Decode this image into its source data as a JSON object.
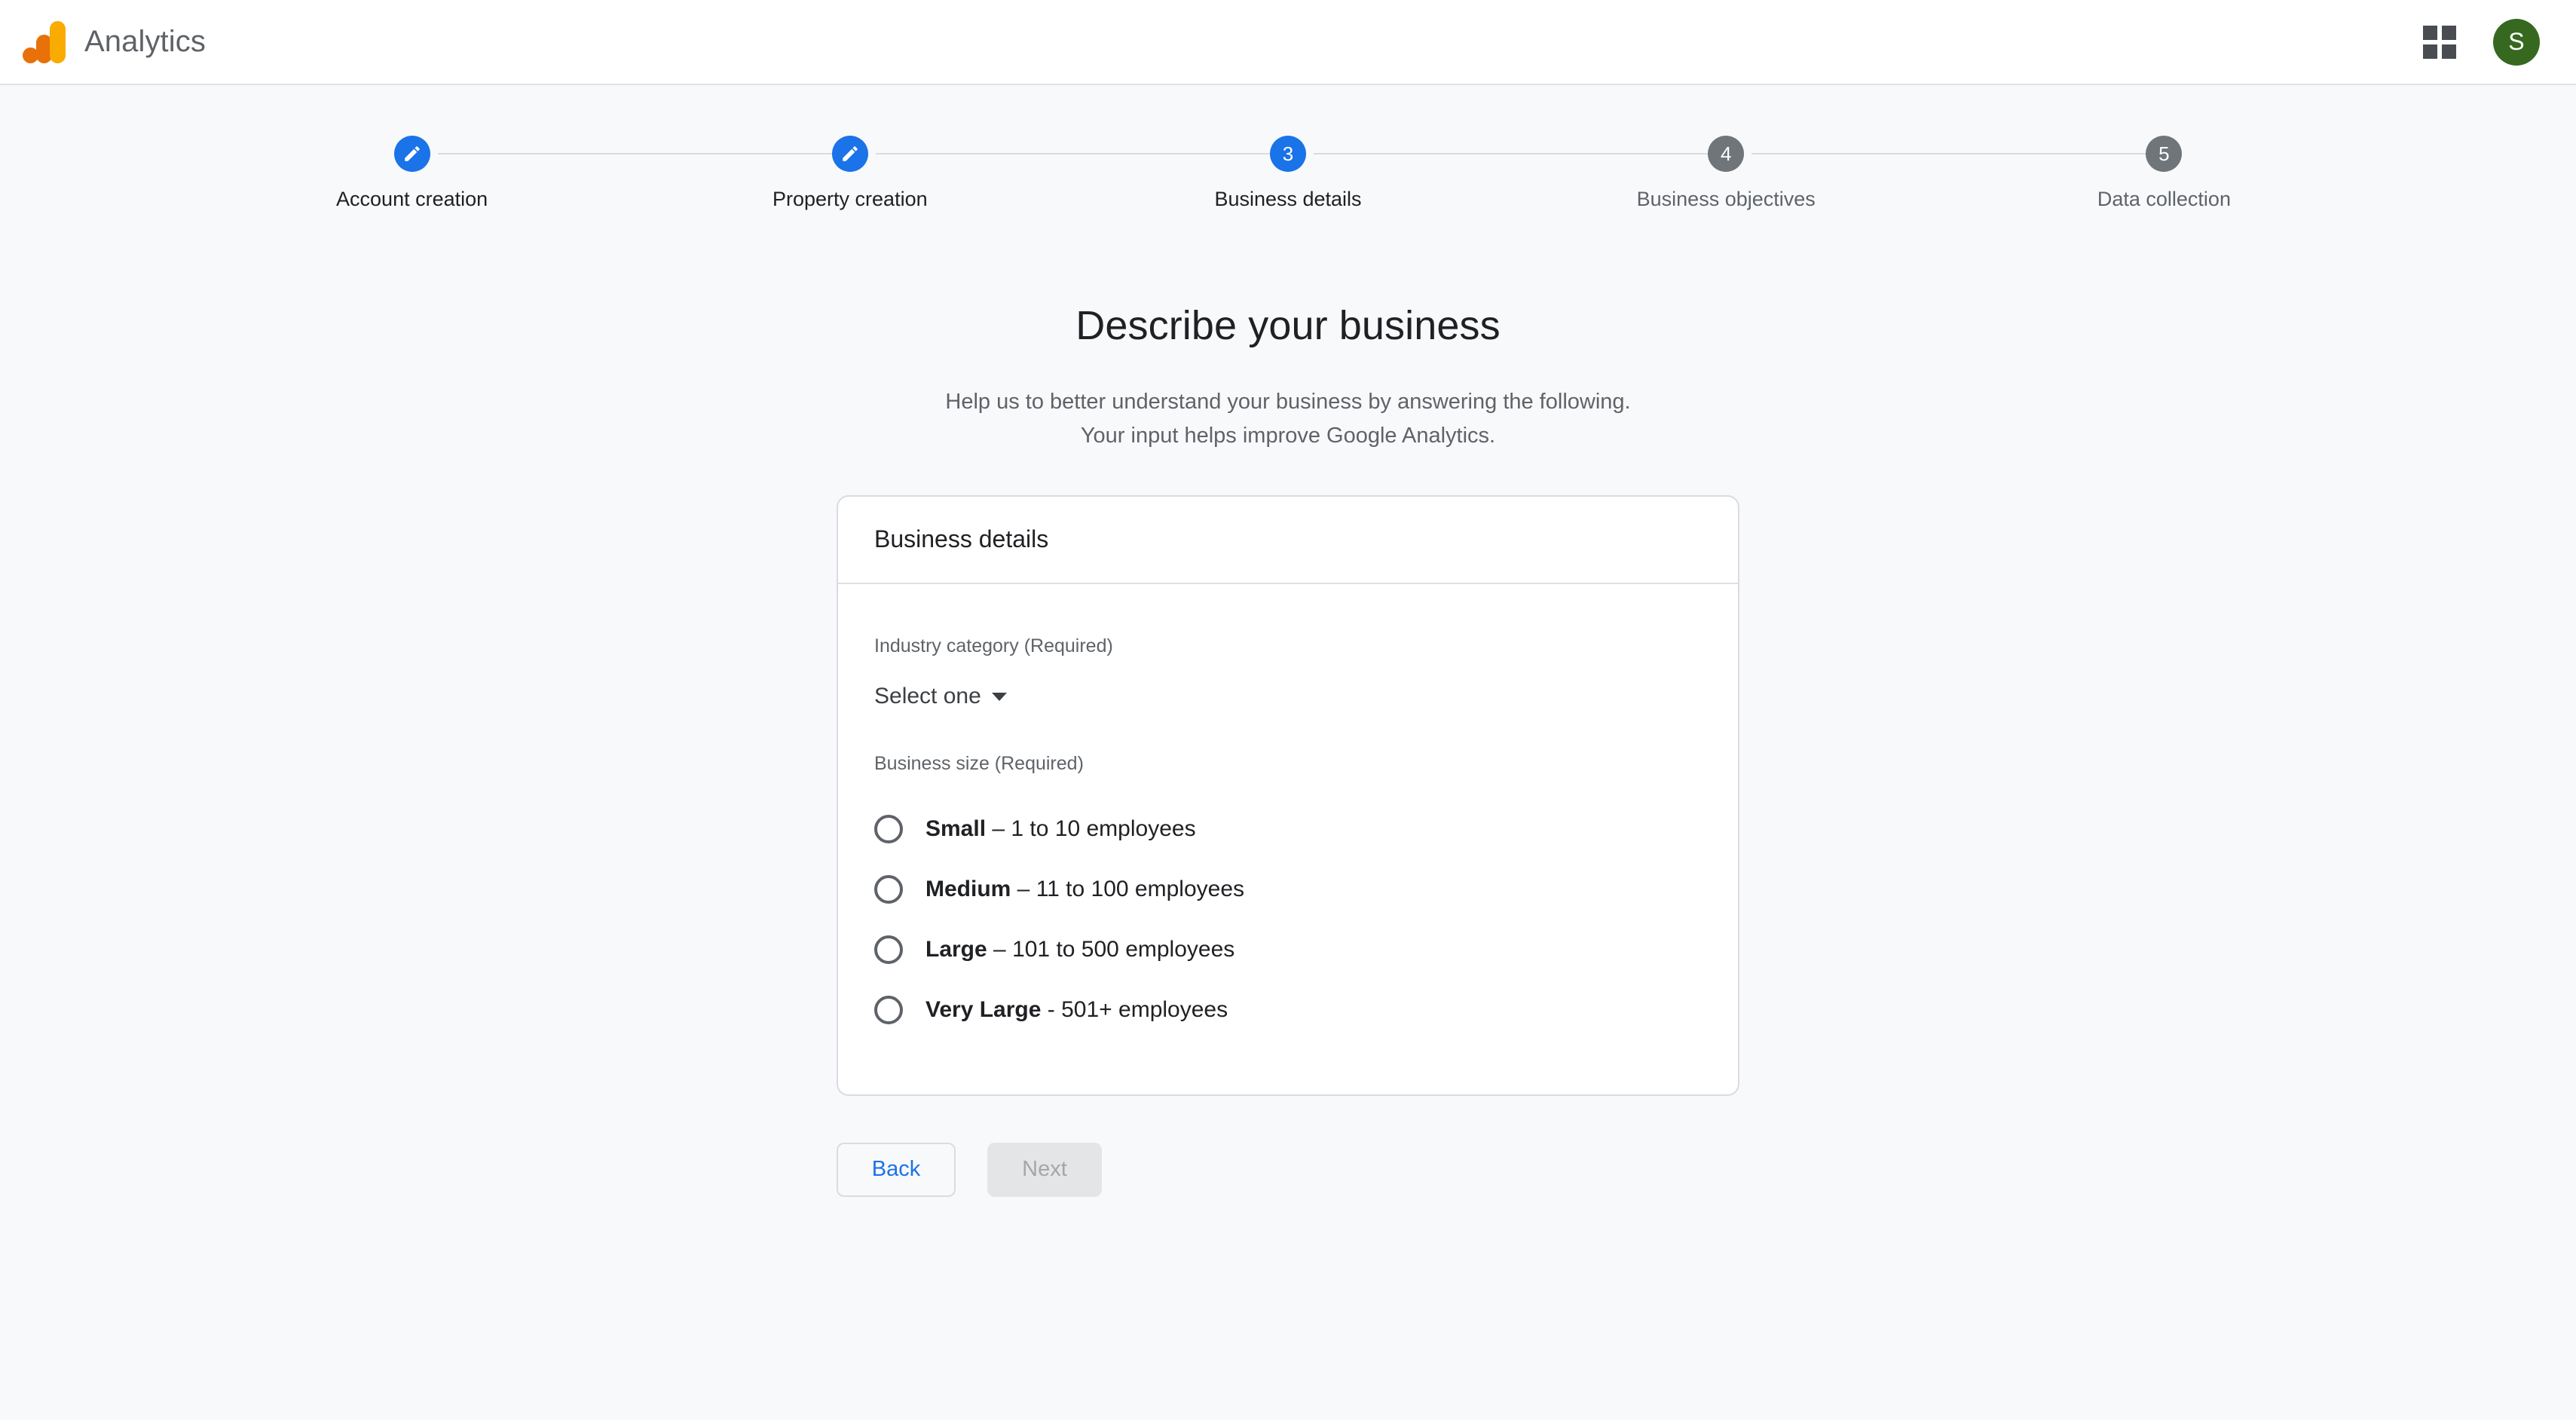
{
  "appbar": {
    "brand_name": "Analytics",
    "logo_icon": "google-analytics-logo",
    "apps_icon": "apps-grid-icon",
    "avatar_initial": "S",
    "avatar_color": "#36691f"
  },
  "stepper": {
    "steps": [
      {
        "marker": "pencil-icon",
        "number": "",
        "label": "Account creation",
        "state": "done"
      },
      {
        "marker": "pencil-icon",
        "number": "",
        "label": "Property creation",
        "state": "done"
      },
      {
        "marker": "number",
        "number": "3",
        "label": "Business details",
        "state": "active"
      },
      {
        "marker": "number",
        "number": "4",
        "label": "Business objectives",
        "state": "todo"
      },
      {
        "marker": "number",
        "number": "5",
        "label": "Data collection",
        "state": "todo"
      }
    ],
    "active_color": "#1a73e8",
    "todo_color": "#70757a"
  },
  "main": {
    "title": "Describe your business",
    "subtitle_line1": "Help us to better understand your business by answering the following.",
    "subtitle_line2": "Your input helps improve Google Analytics."
  },
  "card": {
    "header_title": "Business details",
    "industry": {
      "label": "Industry category (Required)",
      "selected": "Select one",
      "caret_icon": "caret-down-icon"
    },
    "business_size": {
      "label": "Business size (Required)",
      "selected_value": "",
      "options": [
        {
          "name": "Small",
          "dash": " – ",
          "detail": "1 to 10 employees",
          "checked": false
        },
        {
          "name": "Medium",
          "dash": " – ",
          "detail": "11 to 100 employees",
          "checked": false
        },
        {
          "name": "Large",
          "dash": " – ",
          "detail": "101 to 500 employees",
          "checked": false
        },
        {
          "name": "Very Large",
          "dash": " - ",
          "detail": "501+ employees",
          "checked": false
        }
      ]
    }
  },
  "footer": {
    "back_label": "Back",
    "next_label": "Next",
    "next_disabled": true
  }
}
